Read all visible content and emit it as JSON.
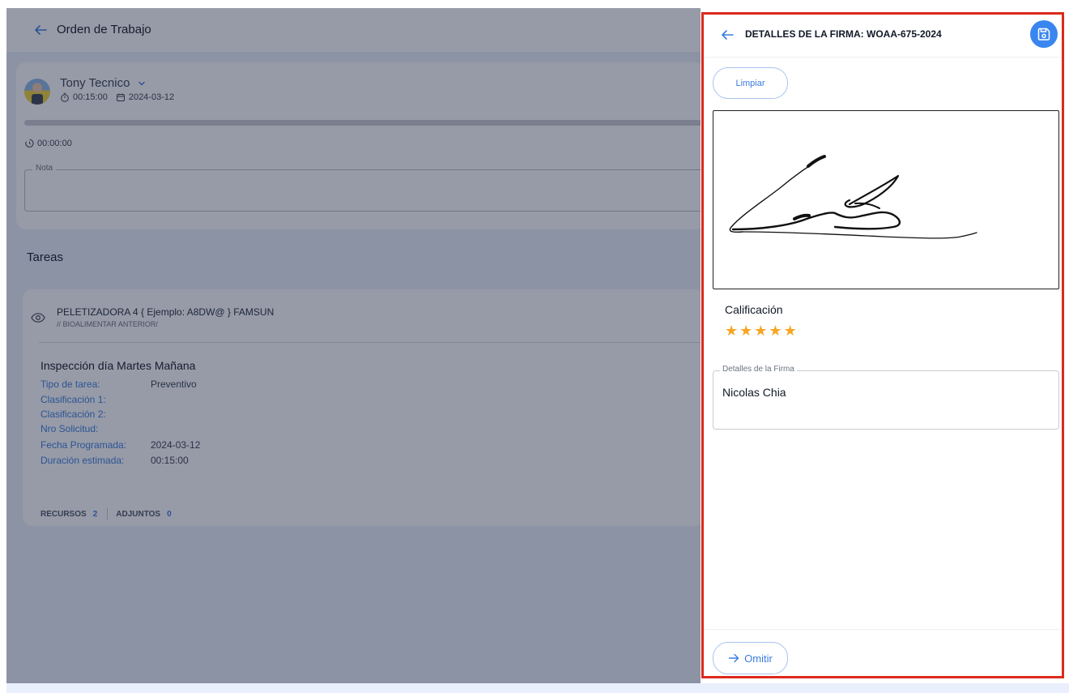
{
  "background": {
    "header_title": "Orden de Trabajo",
    "user": {
      "name": "Tony Tecnico",
      "duration": "00:15:00",
      "date": "2024-03-12"
    },
    "timer": "00:00:00",
    "nota_label": "Nota",
    "tareas_title": "Tareas",
    "task": {
      "title": "PELETIZADORA 4 { Ejemplo: A8DW@ } FAMSUN",
      "subtitle": "// BIOALIMENTAR ANTERIOR/",
      "inspection_title": "Inspección día Martes Mañana",
      "fields": [
        {
          "key": "Tipo de tarea:",
          "value": "Preventivo"
        },
        {
          "key": "Clasificación 1:",
          "value": ""
        },
        {
          "key": "Clasificación 2:",
          "value": ""
        },
        {
          "key": "Nro Solicitud:",
          "value": ""
        },
        {
          "key": "Fecha Programada:",
          "value": "2024-03-12"
        },
        {
          "key": "Duración estimada:",
          "value": "00:15:00"
        }
      ],
      "recursos_label": "RECURSOS",
      "recursos_count": "2",
      "adjuntos_label": "ADJUNTOS",
      "adjuntos_count": "0"
    }
  },
  "panel": {
    "title": "DETALLES DE LA FIRMA: WOAA-675-2024",
    "clear_button": "Limpiar",
    "rating_label": "Calificación",
    "rating": 5,
    "rating_max": 5,
    "signature_details_label": "Detalles de la Firma",
    "signature_details_value": "Nicolas Chia",
    "skip_button": "Omitir"
  },
  "colors": {
    "accent": "#3a86f0",
    "highlight_border": "#dc2a1c",
    "star": "#f5a623",
    "field_key": "#3b7ddd"
  },
  "icons": {
    "back": "arrow-left-icon",
    "save": "floppy-disk-icon",
    "skip": "arrow-right-icon",
    "view": "eye-icon",
    "rating": "star-icon"
  }
}
